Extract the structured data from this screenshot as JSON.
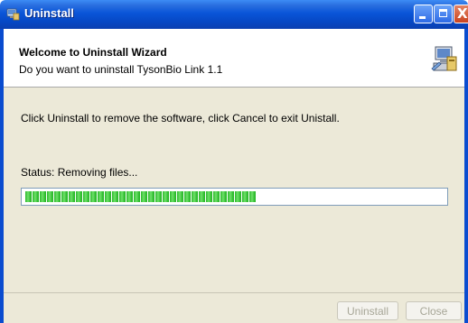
{
  "window": {
    "title": "Uninstall",
    "icons": {
      "app": "uninstall-app-icon",
      "minimize": "minimize-icon",
      "maximize": "maximize-icon",
      "close": "close-icon"
    },
    "close_glyph": "X"
  },
  "header": {
    "title": "Welcome to Uninstall Wizard",
    "subtitle": "Do you want to uninstall TysonBio Link 1.1",
    "icon": "setup-computer-icon"
  },
  "body": {
    "instruction": "Click Uninstall to remove the software, click Cancel to exit Unistall.",
    "status": "Status: Removing files...",
    "progress_percent": 55
  },
  "buttons": {
    "uninstall": "Uninstall",
    "close": "Close",
    "enabled": false
  },
  "colors": {
    "titlebar": "#0a55d8",
    "dialog_bg": "#ece9d8",
    "progress_green": "#2bb92b"
  }
}
